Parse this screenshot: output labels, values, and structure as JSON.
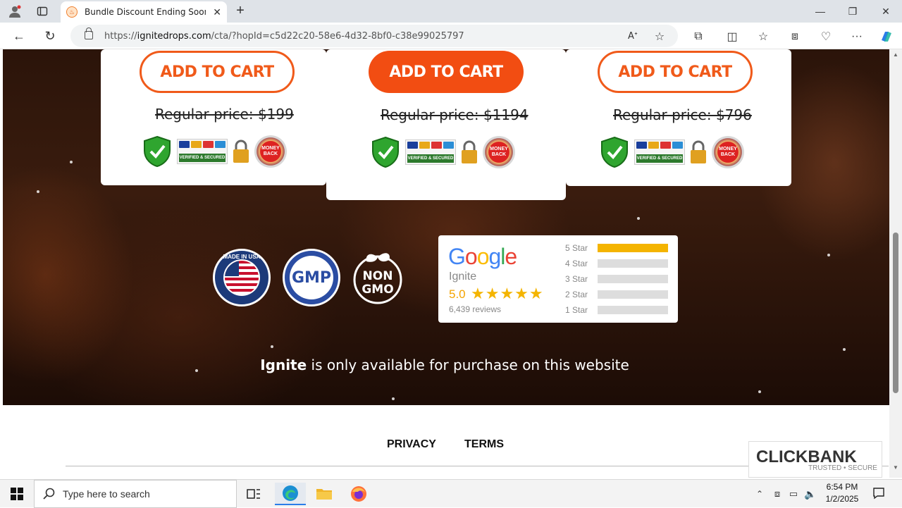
{
  "browser": {
    "tab_title": "Bundle Discount Ending Soon Ge",
    "url_prefix": "https://",
    "url_host": "ignitedrops.com",
    "url_path": "/cta/?hopId=c5d22c20-58e6-4d32-8bf0-c38e99025797"
  },
  "products": [
    {
      "button_label": "ADD TO CART",
      "regular_price": "Regular price: $199"
    },
    {
      "button_label": "ADD TO CART",
      "regular_price": "Regular price: $1194"
    },
    {
      "button_label": "ADD TO CART",
      "regular_price": "Regular price: $796"
    }
  ],
  "trust_badges": {
    "secure": "SECURE",
    "verified": "VERIFIED & SECURED",
    "money_back": "MONEY BACK GUARANTEE"
  },
  "emblems": {
    "usa_top": "MADE IN USA",
    "gmp_text": "GMP",
    "non_gmo_line1": "NON",
    "non_gmo_line2": "GMO"
  },
  "review_widget": {
    "logo_letters": [
      "G",
      "o",
      "o",
      "g",
      "l",
      "e"
    ],
    "logo_colors": [
      "#4285F4",
      "#EA4335",
      "#FBBC05",
      "#4285F4",
      "#34A853",
      "#EA4335"
    ],
    "brand": "Ignite",
    "rating": "5.0",
    "stars": "★★★★★",
    "review_count": "6,439 reviews",
    "distribution": [
      {
        "label": "5 Star",
        "fraction": 1.0
      },
      {
        "label": "4 Star",
        "fraction": 0
      },
      {
        "label": "3 Star",
        "fraction": 0
      },
      {
        "label": "2 Star",
        "fraction": 0
      },
      {
        "label": "1 Star",
        "fraction": 0
      }
    ]
  },
  "availability": {
    "brand": "Ignite",
    "rest": " is only available for purchase on this website"
  },
  "footer": {
    "privacy": "PRIVACY",
    "terms": "TERMS",
    "clickbank_title": "CLICKBANK",
    "clickbank_sub": "TRUSTED • SECURE"
  },
  "taskbar": {
    "search_placeholder": "Type here to search",
    "time": "6:54 PM",
    "date": "1/2/2025"
  },
  "colors": {
    "accent": "#f24d12",
    "star": "#f4b400"
  }
}
